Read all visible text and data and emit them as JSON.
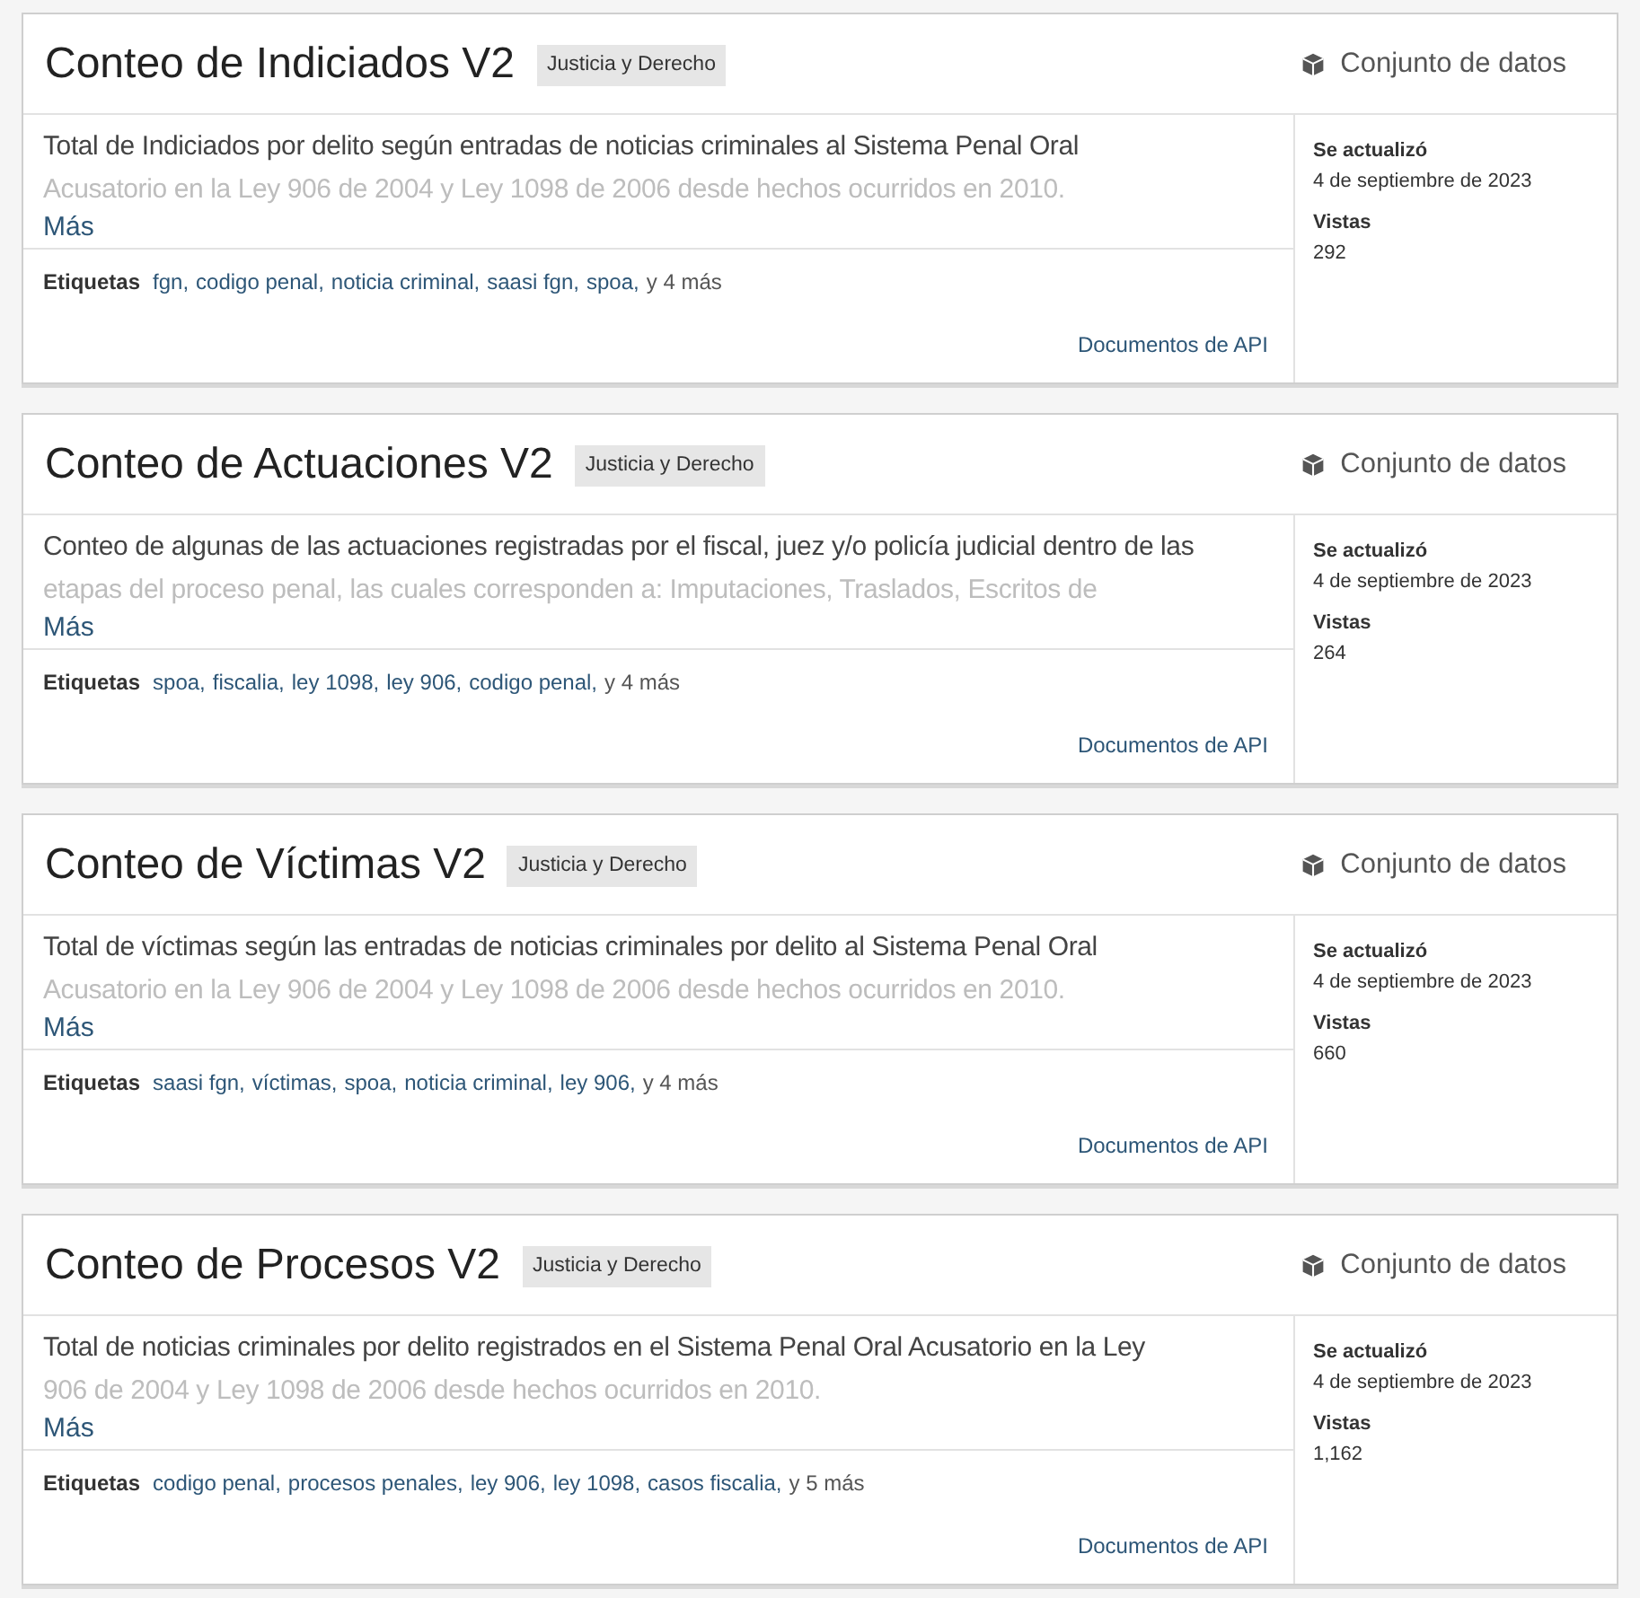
{
  "results": [
    {
      "title": "Conteo de Indiciados V2",
      "category": "Justicia y Derecho",
      "type_label": "Conjunto de datos",
      "description_lines": [
        "Total de Indiciados por delito según entradas de noticias criminales al Sistema Penal Oral",
        "Acusatorio en la Ley 906 de 2004 y Ley 1098 de 2006 desde hechos ocurridos en 2010."
      ],
      "more_link": "Más",
      "tags_label": "Etiquetas",
      "tags": [
        "fgn,",
        "codigo penal,",
        "noticia criminal,",
        "saasi fgn,",
        "spoa,"
      ],
      "tags_more": "y 4 más",
      "api_link": "Documentos de API",
      "updated_label": "Se actualizó",
      "updated": "4 de septiembre de 2023",
      "views_label": "Vistas",
      "views": "292"
    },
    {
      "title": "Conteo de Actuaciones V2",
      "category": "Justicia y Derecho",
      "type_label": "Conjunto de datos",
      "description_lines": [
        "Conteo de algunas de las actuaciones registradas por el fiscal, juez y/o policía judicial dentro de las",
        "etapas del proceso penal, las cuales corresponden a: Imputaciones, Traslados, Escritos de"
      ],
      "more_link": "Más",
      "tags_label": "Etiquetas",
      "tags": [
        "spoa,",
        "fiscalia,",
        "ley 1098,",
        "ley 906,",
        "codigo penal,"
      ],
      "tags_more": "y 4 más",
      "api_link": "Documentos de API",
      "updated_label": "Se actualizó",
      "updated": "4 de septiembre de 2023",
      "views_label": "Vistas",
      "views": "264"
    },
    {
      "title": "Conteo de Víctimas V2",
      "category": "Justicia y Derecho",
      "type_label": "Conjunto de datos",
      "description_lines": [
        "Total de víctimas según las entradas de noticias criminales por delito al Sistema Penal Oral",
        "Acusatorio en la Ley 906 de 2004 y Ley 1098 de 2006 desde hechos ocurridos en 2010."
      ],
      "more_link": "Más",
      "tags_label": "Etiquetas",
      "tags": [
        "saasi fgn,",
        "víctimas,",
        "spoa,",
        "noticia criminal,",
        "ley 906,"
      ],
      "tags_more": "y 4 más",
      "api_link": "Documentos de API",
      "updated_label": "Se actualizó",
      "updated": "4 de septiembre de 2023",
      "views_label": "Vistas",
      "views": "660"
    },
    {
      "title": "Conteo de Procesos V2",
      "category": "Justicia y Derecho",
      "type_label": "Conjunto de datos",
      "description_lines": [
        "Total de noticias criminales por delito registrados en el Sistema Penal Oral Acusatorio en la Ley",
        "906 de 2004 y Ley 1098 de 2006 desde hechos ocurridos en 2010."
      ],
      "more_link": "Más",
      "tags_label": "Etiquetas",
      "tags": [
        "codigo penal,",
        "procesos penales,",
        "ley 906,",
        "ley 1098,",
        "casos fiscalia,"
      ],
      "tags_more": "y 5 más",
      "api_link": "Documentos de API",
      "updated_label": "Se actualizó",
      "updated": "4 de septiembre de 2023",
      "views_label": "Vistas",
      "views": "1,162"
    }
  ]
}
